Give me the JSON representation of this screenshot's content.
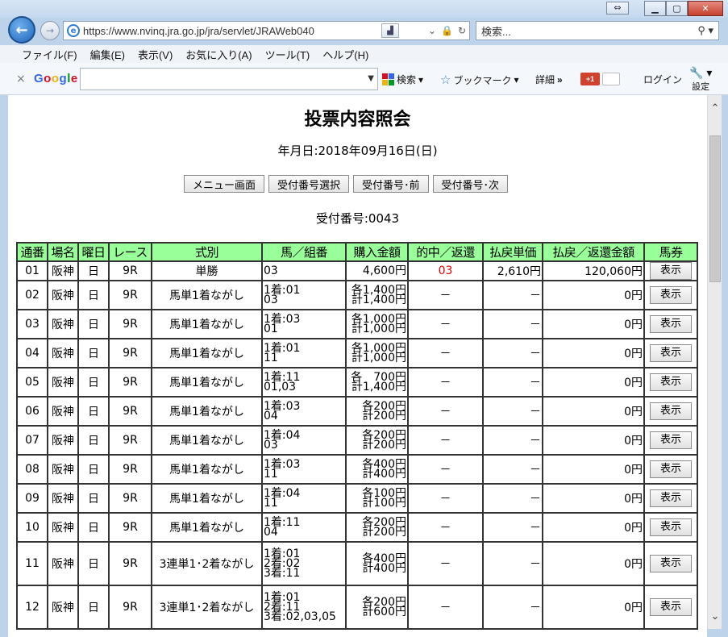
{
  "browser": {
    "url": "https://www.nvinq.jra.go.jp/jra/servlet/JRAWeb040",
    "search_placeholder": "検索...",
    "menu": [
      "ファイル(F)",
      "編集(E)",
      "表示(V)",
      "お気に入り(A)",
      "ツール(T)",
      "ヘルプ(H)"
    ],
    "google_toolbar": {
      "search_label": "検索",
      "bookmark_label": "ブックマーク",
      "details_label": "詳細",
      "more_label": "»",
      "gplus_label": "+1",
      "login_label": "ログイン",
      "settings_label": "設定"
    }
  },
  "page": {
    "title": "投票内容照会",
    "date_line": "年月日:2018年09月16日(日)",
    "buttons": [
      "メニュー画面",
      "受付番号選択",
      "受付番号･前",
      "受付番号･次"
    ],
    "receipt_number": "受付番号:0043"
  },
  "table": {
    "headers": [
      "通番",
      "場名",
      "曜日",
      "レース",
      "式別",
      "馬／組番",
      "購入金額",
      "的中／返還",
      "払戻単価",
      "払戻／返還金額",
      "馬券"
    ],
    "rows": [
      {
        "no": "01",
        "place": "阪神",
        "day": "日",
        "race": "9R",
        "type": "単勝",
        "horse": [
          "03"
        ],
        "amount": [
          "4,600円"
        ],
        "hit": "03",
        "hit_red": true,
        "unit": "2,610円",
        "refund": "120,060円",
        "ticket": "表示"
      },
      {
        "no": "02",
        "place": "阪神",
        "day": "日",
        "race": "9R",
        "type": "馬単1着ながし",
        "horse": [
          "1着:01",
          "03"
        ],
        "amount": [
          "各1,400円",
          "計1,400円"
        ],
        "hit": "－",
        "hit_red": false,
        "unit": "－",
        "refund": "0円",
        "ticket": "表示"
      },
      {
        "no": "03",
        "place": "阪神",
        "day": "日",
        "race": "9R",
        "type": "馬単1着ながし",
        "horse": [
          "1着:03",
          "01"
        ],
        "amount": [
          "各1,000円",
          "計1,000円"
        ],
        "hit": "－",
        "hit_red": false,
        "unit": "－",
        "refund": "0円",
        "ticket": "表示"
      },
      {
        "no": "04",
        "place": "阪神",
        "day": "日",
        "race": "9R",
        "type": "馬単1着ながし",
        "horse": [
          "1着:01",
          "11"
        ],
        "amount": [
          "各1,000円",
          "計1,000円"
        ],
        "hit": "－",
        "hit_red": false,
        "unit": "－",
        "refund": "0円",
        "ticket": "表示"
      },
      {
        "no": "05",
        "place": "阪神",
        "day": "日",
        "race": "9R",
        "type": "馬単1着ながし",
        "horse": [
          "1着:11",
          "01,03"
        ],
        "amount": [
          "各　700円",
          "計1,400円"
        ],
        "hit": "－",
        "hit_red": false,
        "unit": "－",
        "refund": "0円",
        "ticket": "表示"
      },
      {
        "no": "06",
        "place": "阪神",
        "day": "日",
        "race": "9R",
        "type": "馬単1着ながし",
        "horse": [
          "1着:03",
          "04"
        ],
        "amount": [
          "各200円",
          "計200円"
        ],
        "hit": "－",
        "hit_red": false,
        "unit": "－",
        "refund": "0円",
        "ticket": "表示"
      },
      {
        "no": "07",
        "place": "阪神",
        "day": "日",
        "race": "9R",
        "type": "馬単1着ながし",
        "horse": [
          "1着:04",
          "03"
        ],
        "amount": [
          "各200円",
          "計200円"
        ],
        "hit": "－",
        "hit_red": false,
        "unit": "－",
        "refund": "0円",
        "ticket": "表示"
      },
      {
        "no": "08",
        "place": "阪神",
        "day": "日",
        "race": "9R",
        "type": "馬単1着ながし",
        "horse": [
          "1着:03",
          "11"
        ],
        "amount": [
          "各400円",
          "計400円"
        ],
        "hit": "－",
        "hit_red": false,
        "unit": "－",
        "refund": "0円",
        "ticket": "表示"
      },
      {
        "no": "09",
        "place": "阪神",
        "day": "日",
        "race": "9R",
        "type": "馬単1着ながし",
        "horse": [
          "1着:04",
          "11"
        ],
        "amount": [
          "各100円",
          "計100円"
        ],
        "hit": "－",
        "hit_red": false,
        "unit": "－",
        "refund": "0円",
        "ticket": "表示"
      },
      {
        "no": "10",
        "place": "阪神",
        "day": "日",
        "race": "9R",
        "type": "馬単1着ながし",
        "horse": [
          "1着:11",
          "04"
        ],
        "amount": [
          "各200円",
          "計200円"
        ],
        "hit": "－",
        "hit_red": false,
        "unit": "－",
        "refund": "0円",
        "ticket": "表示"
      },
      {
        "no": "11",
        "place": "阪神",
        "day": "日",
        "race": "9R",
        "type": "3連単1･2着ながし",
        "horse": [
          "1着:01",
          "2着:02",
          "3着:11"
        ],
        "amount": [
          "各400円",
          "計400円"
        ],
        "hit": "－",
        "hit_red": false,
        "unit": "－",
        "refund": "0円",
        "ticket": "表示"
      },
      {
        "no": "12",
        "place": "阪神",
        "day": "日",
        "race": "9R",
        "type": "3連単1･2着ながし",
        "horse": [
          "1着:01",
          "2着:11",
          "3着:02,03,05"
        ],
        "amount": [
          "各200円",
          "計600円"
        ],
        "hit": "－",
        "hit_red": false,
        "unit": "－",
        "refund": "0円",
        "ticket": "表示"
      }
    ]
  }
}
